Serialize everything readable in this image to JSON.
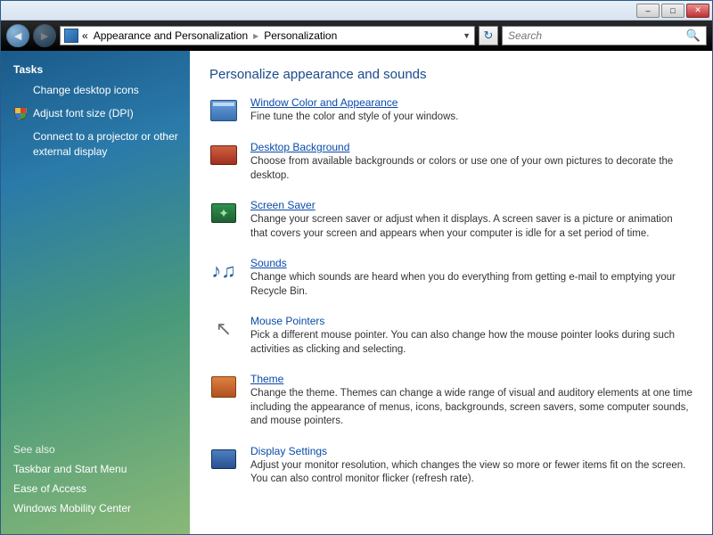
{
  "titlebar": {
    "min_label": "–",
    "max_label": "□",
    "close_label": "✕"
  },
  "address": {
    "chevrons": "«",
    "part1": "Appearance and Personalization",
    "part2": "Personalization"
  },
  "search": {
    "placeholder": "Search"
  },
  "sidebar": {
    "tasks_title": "Tasks",
    "tasks": [
      {
        "label": "Change desktop icons",
        "shield": false
      },
      {
        "label": "Adjust font size (DPI)",
        "shield": true
      },
      {
        "label": "Connect to a projector or other external display",
        "shield": false
      }
    ],
    "seealso_title": "See also",
    "seealso": [
      {
        "label": "Taskbar and Start Menu"
      },
      {
        "label": "Ease of Access"
      },
      {
        "label": "Windows Mobility Center"
      }
    ]
  },
  "content": {
    "heading": "Personalize appearance and sounds",
    "entries": [
      {
        "title": "Window Color and Appearance",
        "desc": "Fine tune the color and style of your windows.",
        "icon": "window-color-icon",
        "underline": true
      },
      {
        "title": "Desktop Background",
        "desc": "Choose from available backgrounds or colors or use one of your own pictures to decorate the desktop.",
        "icon": "desktop-background-icon",
        "underline": true
      },
      {
        "title": "Screen Saver",
        "desc": "Change your screen saver or adjust when it displays. A screen saver is a picture or animation that covers your screen and appears when your computer is idle for a set period of time.",
        "icon": "screen-saver-icon",
        "underline": true
      },
      {
        "title": "Sounds",
        "desc": "Change which sounds are heard when you do everything from getting e-mail to emptying your Recycle Bin.",
        "icon": "sounds-icon",
        "underline": true
      },
      {
        "title": "Mouse Pointers",
        "desc": "Pick a different mouse pointer. You can also change how the mouse pointer looks during such activities as clicking and selecting.",
        "icon": "mouse-pointers-icon",
        "underline": false
      },
      {
        "title": "Theme",
        "desc": "Change the theme. Themes can change a wide range of visual and auditory elements at one time including the appearance of menus, icons, backgrounds, screen savers, some computer sounds, and mouse pointers.",
        "icon": "theme-icon",
        "underline": true
      },
      {
        "title": "Display Settings",
        "desc": "Adjust your monitor resolution, which changes the view so more or fewer items fit on the screen. You can also control monitor flicker (refresh rate).",
        "icon": "display-settings-icon",
        "underline": false
      }
    ]
  }
}
